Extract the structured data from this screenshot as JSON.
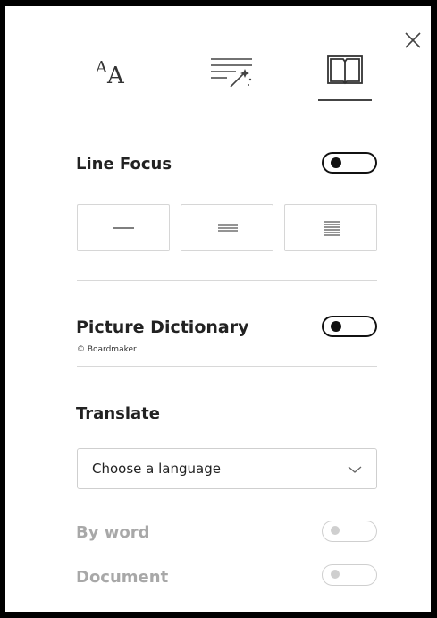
{
  "close": {
    "icon": "close-icon"
  },
  "tabs": [
    {
      "id": "text-options",
      "icon": "text-size-icon",
      "glyph_big": "A",
      "glyph_small": "A",
      "selected": false
    },
    {
      "id": "grammar-options",
      "icon": "grammar-sparkle-icon",
      "selected": false
    },
    {
      "id": "reading-preferences",
      "icon": "book-icon",
      "selected": true
    }
  ],
  "line_focus": {
    "label": "Line Focus",
    "enabled": false,
    "options": [
      {
        "id": "one-line",
        "icon": "one-line-icon"
      },
      {
        "id": "three-lines",
        "icon": "three-lines-icon"
      },
      {
        "id": "five-lines",
        "icon": "five-lines-icon"
      }
    ]
  },
  "picture_dictionary": {
    "label": "Picture Dictionary",
    "caption": "© Boardmaker",
    "enabled": false
  },
  "translate": {
    "label": "Translate",
    "select_value": "Choose a language",
    "by_word": {
      "label": "By word",
      "enabled": false,
      "disabled": true
    },
    "document": {
      "label": "Document",
      "enabled": false,
      "disabled": true
    }
  },
  "colors": {
    "text": "#222222",
    "disabled_text": "#a8a8a8",
    "toggle_on_border": "#111111",
    "toggle_disabled": "#cfcfcf",
    "border": "#d6d6d6",
    "frame": "#000000"
  }
}
